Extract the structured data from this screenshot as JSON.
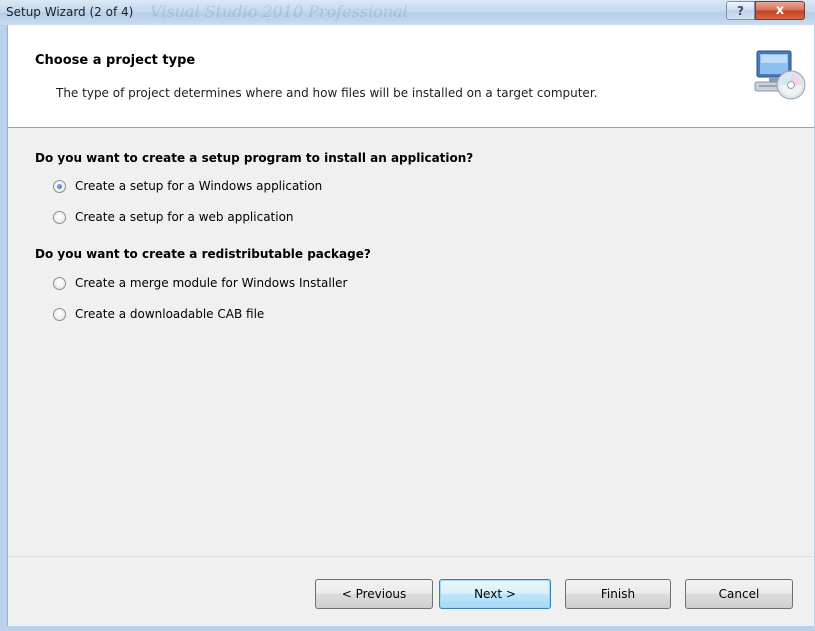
{
  "window": {
    "title": "Setup Wizard (2 of 4)",
    "watermark": "Visual Studio 2010 Professional",
    "help_symbol": "?",
    "close_symbol": "x"
  },
  "header": {
    "title": "Choose a project type",
    "description": "The type of project determines where and how files will be installed on a target computer.",
    "icon": "setup-computer-cd-icon"
  },
  "groups": [
    {
      "heading": "Do you want to create a setup program to install an application?",
      "options": [
        {
          "label": "Create a setup for a Windows application",
          "checked": true
        },
        {
          "label": "Create a setup for a web application",
          "checked": false
        }
      ]
    },
    {
      "heading": "Do you want to create a redistributable package?",
      "options": [
        {
          "label": "Create a merge module for Windows Installer",
          "checked": false
        },
        {
          "label": "Create a downloadable CAB file",
          "checked": false
        }
      ]
    }
  ],
  "buttons": {
    "previous": "< Previous",
    "next": "Next >",
    "finish": "Finish",
    "cancel": "Cancel"
  },
  "colors": {
    "frame": "#b9d1ea",
    "content_bg": "#f0f0f0",
    "header_bg": "#ffffff",
    "close_button": "#c2401e",
    "default_button_border": "#3c7fb1"
  }
}
